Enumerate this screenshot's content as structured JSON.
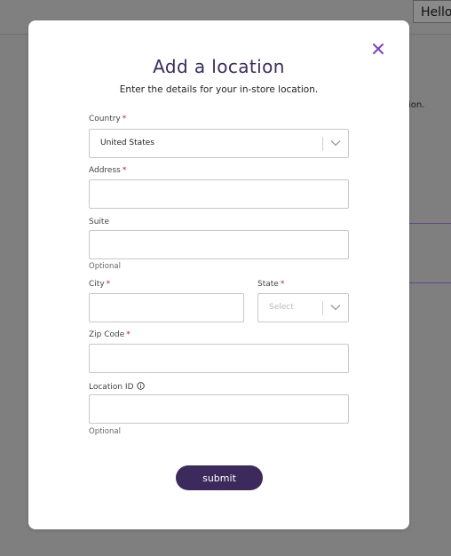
{
  "background": {
    "header_button": "Hello",
    "partial_text": "ion."
  },
  "modal": {
    "title": "Add a location",
    "subtitle": "Enter the details for your in-store location.",
    "required_marker": "*",
    "fields": {
      "country": {
        "label": "Country",
        "value": "United States"
      },
      "address": {
        "label": "Address",
        "value": ""
      },
      "suite": {
        "label": "Suite",
        "value": "",
        "hint": "Optional"
      },
      "city": {
        "label": "City",
        "value": ""
      },
      "state": {
        "label": "State",
        "placeholder": "Select"
      },
      "zip": {
        "label": "Zip Code",
        "value": ""
      },
      "location_id": {
        "label": "Location ID",
        "value": "",
        "hint": "Optional"
      }
    },
    "submit_label": "submit"
  },
  "colors": {
    "title": "#3b2a63",
    "close_icon": "#7b3fd1",
    "required": "#c2185b",
    "submit_bg": "#3d2a5d"
  },
  "icons": {
    "close": "close-icon",
    "dropdown": "chevron-down-icon",
    "info": "info-icon"
  }
}
